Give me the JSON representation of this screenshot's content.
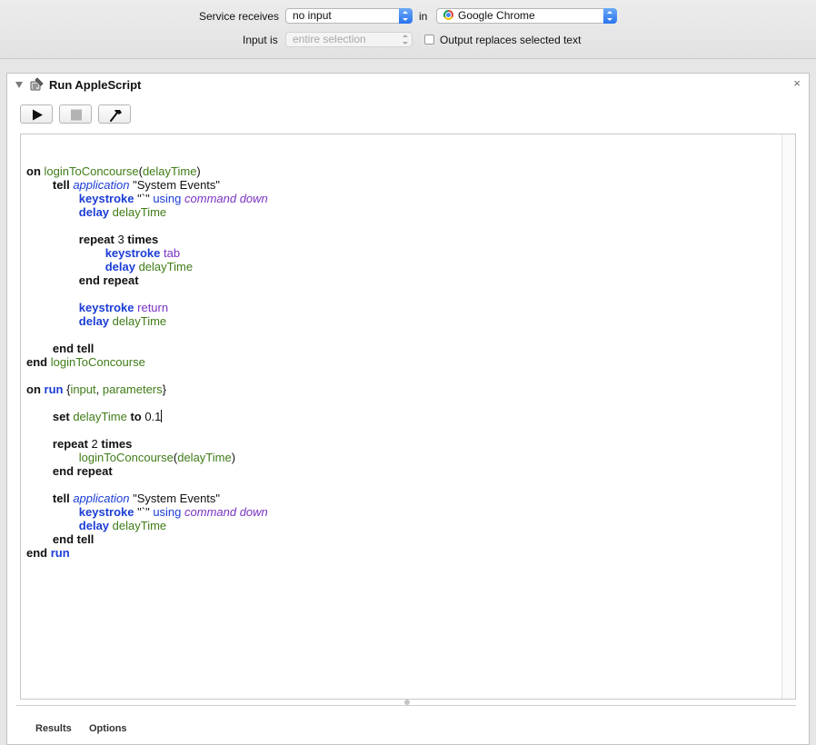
{
  "service_bar": {
    "receives_label": "Service receives",
    "receives_value": "no input",
    "in_label": "in",
    "app_value": "Google Chrome",
    "input_is_label": "Input is",
    "input_is_value": "entire selection",
    "replace_label": "Output replaces selected text",
    "replace_checked": false
  },
  "action": {
    "title": "Run AppleScript",
    "close_glyph": "×",
    "toolbar": [
      {
        "name": "run-button",
        "icon": "play-icon",
        "enabled": true
      },
      {
        "name": "stop-button",
        "icon": "stop-icon",
        "enabled": false
      },
      {
        "name": "compile-button",
        "icon": "hammer-icon",
        "enabled": true
      }
    ]
  },
  "script": {
    "lines": [
      [
        [
          "kw",
          "on"
        ],
        [
          "p",
          " "
        ],
        [
          "var",
          "loginToConcourse"
        ],
        [
          "p",
          "("
        ],
        [
          "var",
          "delayTime"
        ],
        [
          "p",
          ")"
        ]
      ],
      [
        [
          "p",
          "        "
        ],
        [
          "kw",
          "tell"
        ],
        [
          "p",
          " "
        ],
        [
          "app",
          "application"
        ],
        [
          "p",
          " \"System Events\""
        ]
      ],
      [
        [
          "p",
          "                "
        ],
        [
          "cmd",
          "keystroke"
        ],
        [
          "p",
          " \"`\" "
        ],
        [
          "cl",
          "using"
        ],
        [
          "p",
          " "
        ],
        [
          "it",
          "command down"
        ]
      ],
      [
        [
          "p",
          "                "
        ],
        [
          "cmd",
          "delay"
        ],
        [
          "p",
          " "
        ],
        [
          "var",
          "delayTime"
        ]
      ],
      [],
      [
        [
          "p",
          "                "
        ],
        [
          "kw",
          "repeat"
        ],
        [
          "p",
          " 3 "
        ],
        [
          "kw",
          "times"
        ]
      ],
      [
        [
          "p",
          "                        "
        ],
        [
          "cmd",
          "keystroke"
        ],
        [
          "p",
          " "
        ],
        [
          "enum",
          "tab"
        ]
      ],
      [
        [
          "p",
          "                        "
        ],
        [
          "cmd",
          "delay"
        ],
        [
          "p",
          " "
        ],
        [
          "var",
          "delayTime"
        ]
      ],
      [
        [
          "p",
          "                "
        ],
        [
          "kw",
          "end repeat"
        ]
      ],
      [],
      [
        [
          "p",
          "                "
        ],
        [
          "cmd",
          "keystroke"
        ],
        [
          "p",
          " "
        ],
        [
          "enum",
          "return"
        ]
      ],
      [
        [
          "p",
          "                "
        ],
        [
          "cmd",
          "delay"
        ],
        [
          "p",
          " "
        ],
        [
          "var",
          "delayTime"
        ]
      ],
      [],
      [
        [
          "p",
          "        "
        ],
        [
          "kw",
          "end tell"
        ]
      ],
      [
        [
          "kw",
          "end"
        ],
        [
          "p",
          " "
        ],
        [
          "var",
          "loginToConcourse"
        ]
      ],
      [],
      [
        [
          "kw",
          "on"
        ],
        [
          "p",
          " "
        ],
        [
          "cmd",
          "run"
        ],
        [
          "p",
          " {"
        ],
        [
          "var",
          "input"
        ],
        [
          "p",
          ", "
        ],
        [
          "var",
          "parameters"
        ],
        [
          "p",
          "}"
        ]
      ],
      [],
      [
        [
          "p",
          "        "
        ],
        [
          "kw",
          "set"
        ],
        [
          "p",
          " "
        ],
        [
          "var",
          "delayTime"
        ],
        [
          "p",
          " "
        ],
        [
          "kw",
          "to"
        ],
        [
          "p",
          " 0.1"
        ],
        [
          "caret",
          ""
        ]
      ],
      [],
      [
        [
          "p",
          "        "
        ],
        [
          "kw",
          "repeat"
        ],
        [
          "p",
          " 2 "
        ],
        [
          "kw",
          "times"
        ]
      ],
      [
        [
          "p",
          "                "
        ],
        [
          "var",
          "loginToConcourse"
        ],
        [
          "p",
          "("
        ],
        [
          "var",
          "delayTime"
        ],
        [
          "p",
          ")"
        ]
      ],
      [
        [
          "p",
          "        "
        ],
        [
          "kw",
          "end repeat"
        ]
      ],
      [],
      [
        [
          "p",
          "        "
        ],
        [
          "kw",
          "tell"
        ],
        [
          "p",
          " "
        ],
        [
          "app",
          "application"
        ],
        [
          "p",
          " \"System Events\""
        ]
      ],
      [
        [
          "p",
          "                "
        ],
        [
          "cmd",
          "keystroke"
        ],
        [
          "p",
          " \"`\" "
        ],
        [
          "cl",
          "using"
        ],
        [
          "p",
          " "
        ],
        [
          "it",
          "command down"
        ]
      ],
      [
        [
          "p",
          "                "
        ],
        [
          "cmd",
          "delay"
        ],
        [
          "p",
          " "
        ],
        [
          "var",
          "delayTime"
        ]
      ],
      [
        [
          "p",
          "        "
        ],
        [
          "kw",
          "end tell"
        ]
      ],
      [
        [
          "kw",
          "end"
        ],
        [
          "p",
          " "
        ],
        [
          "cmd",
          "run"
        ]
      ]
    ]
  },
  "bottom_tabs": [
    "Results",
    "Options"
  ]
}
